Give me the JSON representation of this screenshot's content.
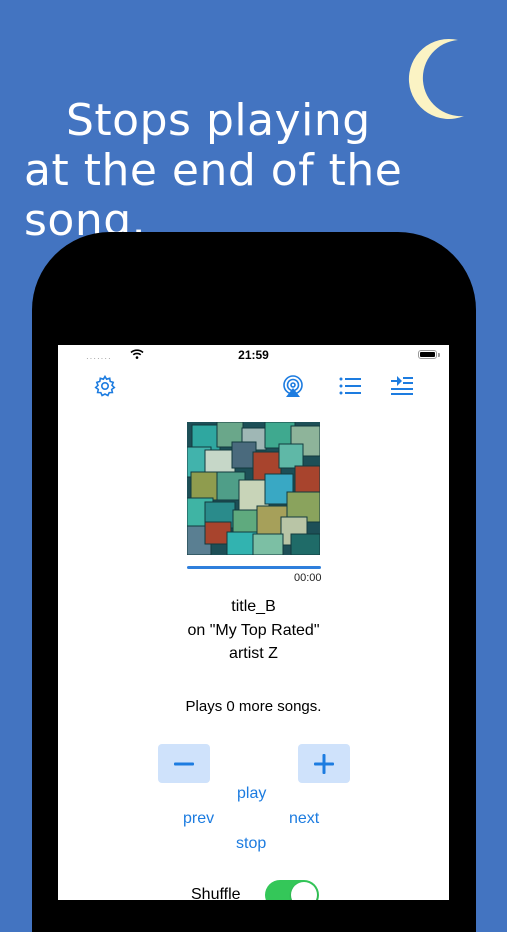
{
  "headline": {
    "line1": "Stops playing",
    "line2": "at the end of the song."
  },
  "status_bar": {
    "time": "21:59",
    "signal": "·······"
  },
  "toolbar": {
    "settings_icon": "gear-icon",
    "airplay_icon": "airplay-icon",
    "playlist_icon": "list-icon",
    "queue_icon": "queue-icon"
  },
  "player": {
    "elapsed": "00:00",
    "progress": 1.0,
    "title": "title_B",
    "playlist": "on \"My Top Rated\"",
    "artist": "artist Z",
    "plays_remaining": "Plays 0 more songs."
  },
  "controls": {
    "minus": "−",
    "plus": "+",
    "play": "play",
    "prev": "prev",
    "next": "next",
    "stop": "stop"
  },
  "shuffle": {
    "label": "Shuffle",
    "on": true
  },
  "colors": {
    "background": "#4374c1",
    "accent": "#1d7ce0",
    "moon": "#fbf3c4",
    "toggle_on": "#34c759",
    "step_button": "#cfe2fb"
  }
}
